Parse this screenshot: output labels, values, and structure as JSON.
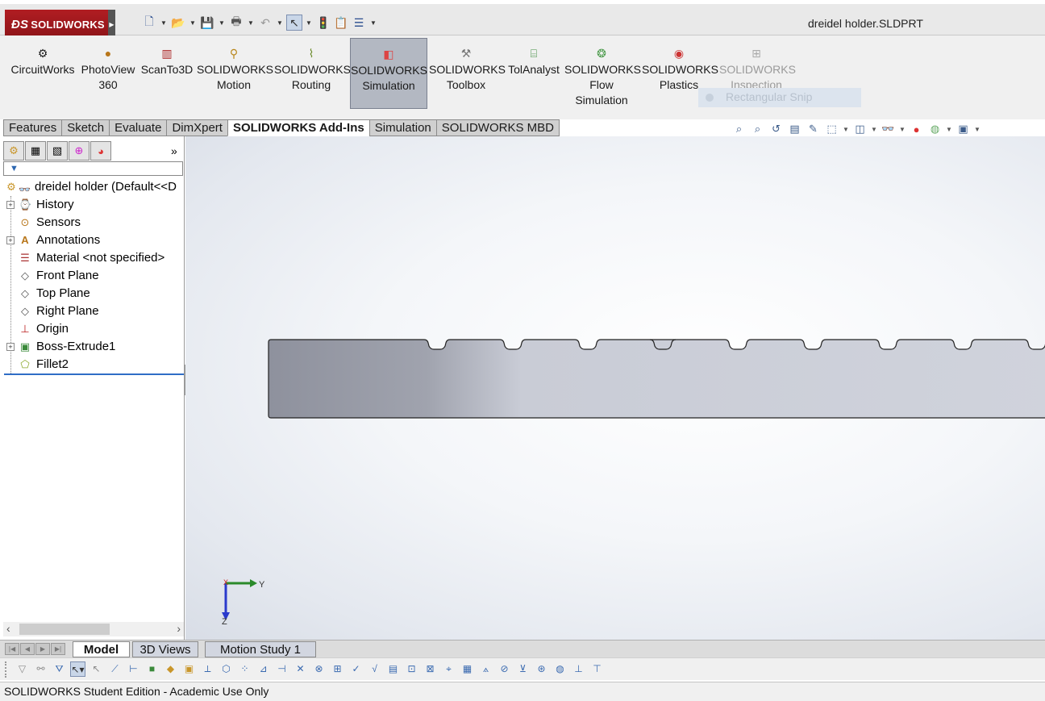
{
  "titlebar": {
    "app_name": "SOLIDWORKS",
    "document_title": "dreidel holder.SLDPRT"
  },
  "command_manager": {
    "buttons": [
      {
        "label": "CircuitWorks",
        "icon": "circuitworks-icon"
      },
      {
        "label": "PhotoView 360",
        "icon": "photoview-icon"
      },
      {
        "label": "ScanTo3D",
        "icon": "scanto3d-icon"
      },
      {
        "label": "SOLIDWORKS Motion",
        "icon": "motion-icon"
      },
      {
        "label": "SOLIDWORKS Routing",
        "icon": "routing-icon"
      },
      {
        "label": "SOLIDWORKS Simulation",
        "icon": "simulation-icon",
        "active": true
      },
      {
        "label": "SOLIDWORKS Toolbox",
        "icon": "toolbox-icon"
      },
      {
        "label": "TolAnalyst",
        "icon": "tolanalyst-icon"
      },
      {
        "label": "SOLIDWORKS Flow Simulation",
        "icon": "flow-simulation-icon"
      },
      {
        "label": "SOLIDWORKS Plastics",
        "icon": "plastics-icon"
      },
      {
        "label": "SOLIDWORKS Inspection",
        "icon": "inspection-icon",
        "disabled": true
      }
    ],
    "snip_overlay": "Rectangular Snip"
  },
  "tabs": [
    "Features",
    "Sketch",
    "Evaluate",
    "DimXpert",
    "SOLIDWORKS Add-Ins",
    "Simulation",
    "SOLIDWORKS MBD"
  ],
  "active_tab": "SOLIDWORKS Add-Ins",
  "feature_tree": {
    "root": "dreidel holder  (Default<<D",
    "items": [
      {
        "label": "History",
        "icon": "history-icon",
        "expandable": true
      },
      {
        "label": "Sensors",
        "icon": "sensors-icon",
        "expandable": false
      },
      {
        "label": "Annotations",
        "icon": "annotations-icon",
        "expandable": true
      },
      {
        "label": "Material <not specified>",
        "icon": "material-icon",
        "expandable": false
      },
      {
        "label": "Front Plane",
        "icon": "plane-icon",
        "expandable": false
      },
      {
        "label": "Top Plane",
        "icon": "plane-icon",
        "expandable": false
      },
      {
        "label": "Right Plane",
        "icon": "plane-icon",
        "expandable": false
      },
      {
        "label": "Origin",
        "icon": "origin-icon",
        "expandable": false
      },
      {
        "label": "Boss-Extrude1",
        "icon": "extrude-icon",
        "expandable": true
      },
      {
        "label": "Fillet2",
        "icon": "fillet-icon",
        "expandable": false
      }
    ]
  },
  "bottom_tabs": [
    "Model",
    "3D Views",
    "Motion Study 1"
  ],
  "active_bottom_tab": "Model",
  "triad": {
    "y_label": "Y",
    "z_label": "Z",
    "x_label": "X"
  },
  "status_bar": "SOLIDWORKS Student Edition - Academic Use Only",
  "colors": {
    "brand_red": "#b11d22",
    "active_command": "#b3b8c2",
    "part_fill": "#c9ccd6"
  }
}
